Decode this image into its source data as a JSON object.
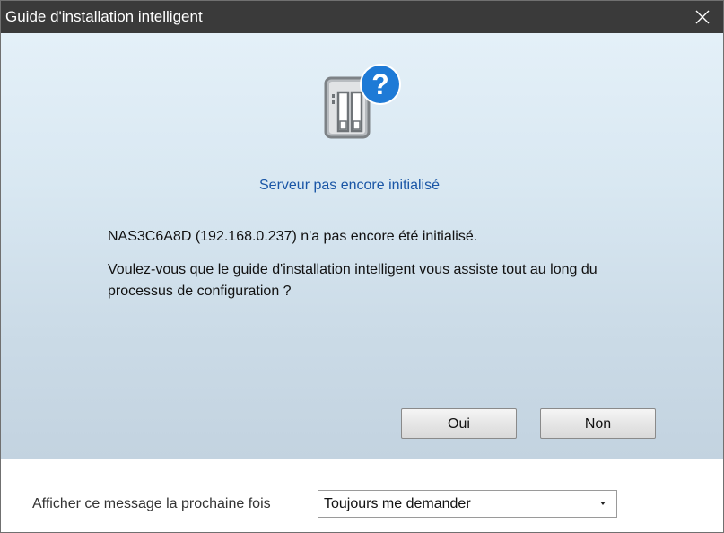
{
  "window": {
    "title": "Guide d'installation intelligent"
  },
  "main": {
    "icon": "nas-device-question-icon",
    "subtitle": "Serveur pas encore initialisé",
    "message_line1": "NAS3C6A8D (192.168.0.237) n'a pas encore été initialisé.",
    "message_line2": "Voulez-vous que le guide d'installation intelligent vous assiste tout au long du processus de configuration ?",
    "buttons": {
      "yes": "Oui",
      "no": "Non"
    }
  },
  "footer": {
    "label": "Afficher ce message la prochaine fois",
    "select_value": "Toujours me demander"
  },
  "colors": {
    "titlebar": "#3a3a3a",
    "subtitle": "#1a56a6",
    "question_badge": "#1e7ad6"
  }
}
